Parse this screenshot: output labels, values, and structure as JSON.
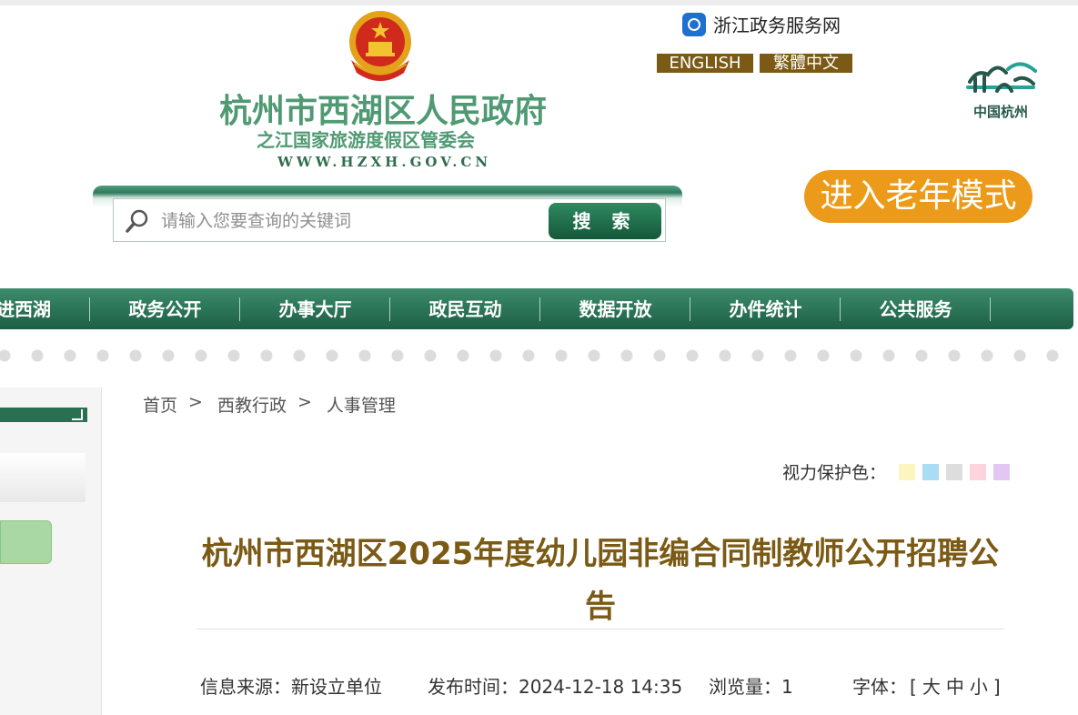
{
  "header": {
    "site_title": "杭州市西湖区人民政府",
    "site_subtitle": "之江国家旅游度假区管委会",
    "site_url": "WWW.HZXH.GOV.CN",
    "zj_service_label": "浙江政务服务网",
    "lang_english": "ENGLISH",
    "lang_traditional": "繁體中文",
    "hz_logo_text": "中国杭州",
    "elder_mode_label": "进入老年模式"
  },
  "search": {
    "placeholder": "请输入您要查询的关键词",
    "button_label": "搜 索"
  },
  "nav": {
    "items": [
      {
        "label": "进西湖"
      },
      {
        "label": "政务公开"
      },
      {
        "label": "办事大厅"
      },
      {
        "label": "政民互动"
      },
      {
        "label": "数据开放"
      },
      {
        "label": "办件统计"
      },
      {
        "label": "公共服务"
      }
    ]
  },
  "breadcrumb": {
    "items": [
      "首页",
      "西教行政",
      "人事管理"
    ],
    "separator": ">"
  },
  "eye_care": {
    "label": "视力保护色：",
    "colors": [
      "#fbf6c0",
      "#a9ddf3",
      "#dddddd",
      "#fdd3de",
      "#e3c7f3"
    ]
  },
  "article": {
    "title": "杭州市西湖区2025年度幼儿园非编合同制教师公开招聘公告",
    "source": "信息来源：新设立单位",
    "publish_time": "发布时间：2024-12-18 14:35",
    "views": "浏览量：1",
    "font_label": "字体：",
    "font_open": "[",
    "font_large": "大",
    "font_medium": "中",
    "font_small": "小",
    "font_close": "]"
  },
  "colors": {
    "brand_green": "#1c5f44",
    "title_brown": "#7a5a14",
    "elder_orange": "#ec9a1a"
  }
}
